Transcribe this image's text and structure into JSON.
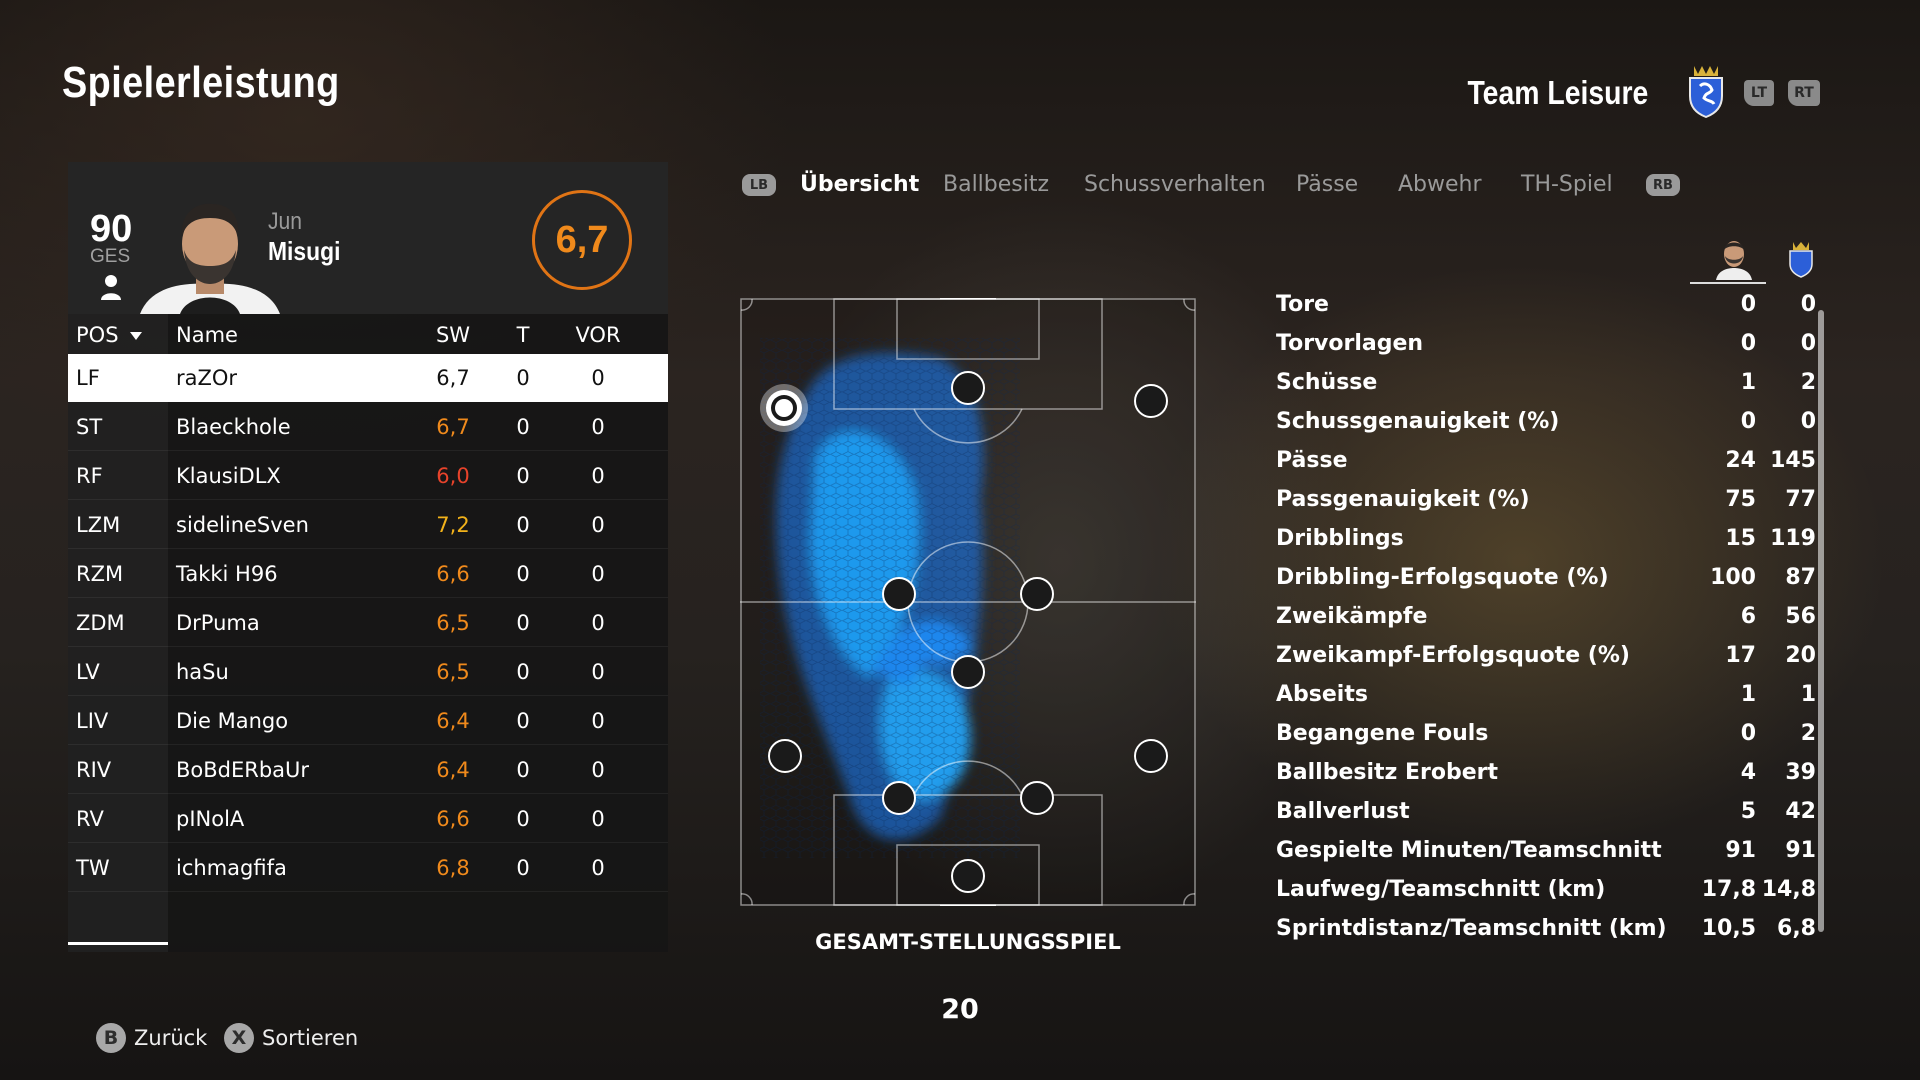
{
  "header": {
    "title": "Spielerleistung",
    "team_name": "Team Leisure",
    "lt_label": "LT",
    "rt_label": "RT"
  },
  "player_card": {
    "overall": "90",
    "overall_label": "GES",
    "first_name": "Jun",
    "last_name": "Misugi",
    "rating": "6,7"
  },
  "table": {
    "columns": [
      "POS",
      "Name",
      "SW",
      "T",
      "VOR"
    ],
    "rows": [
      {
        "pos": "LF",
        "name": "raZOr",
        "sw": "6,7",
        "t": "0",
        "vor": "0",
        "color": "#111111"
      },
      {
        "pos": "ST",
        "name": "Blaeckhole",
        "sw": "6,7",
        "t": "0",
        "vor": "0",
        "color": "#f08a1c"
      },
      {
        "pos": "RF",
        "name": "KlausiDLX",
        "sw": "6,0",
        "t": "0",
        "vor": "0",
        "color": "#e8432b"
      },
      {
        "pos": "LZM",
        "name": "sidelineSven",
        "sw": "7,2",
        "t": "0",
        "vor": "0",
        "color": "#f2b21a"
      },
      {
        "pos": "RZM",
        "name": "Takki H96",
        "sw": "6,6",
        "t": "0",
        "vor": "0",
        "color": "#f08a1c"
      },
      {
        "pos": "ZDM",
        "name": "DrPuma",
        "sw": "6,5",
        "t": "0",
        "vor": "0",
        "color": "#f08a1c"
      },
      {
        "pos": "LV",
        "name": "haSu",
        "sw": "6,5",
        "t": "0",
        "vor": "0",
        "color": "#f08a1c"
      },
      {
        "pos": "LIV",
        "name": "Die Mango",
        "sw": "6,4",
        "t": "0",
        "vor": "0",
        "color": "#f08a1c"
      },
      {
        "pos": "RIV",
        "name": "BoBdERbaUr",
        "sw": "6,4",
        "t": "0",
        "vor": "0",
        "color": "#f08a1c"
      },
      {
        "pos": "RV",
        "name": "pINolA",
        "sw": "6,6",
        "t": "0",
        "vor": "0",
        "color": "#f08a1c"
      },
      {
        "pos": "TW",
        "name": "ichmagfifa",
        "sw": "6,8",
        "t": "0",
        "vor": "0",
        "color": "#f08a1c"
      }
    ]
  },
  "tabs": {
    "lb": "LB",
    "rb": "RB",
    "items": [
      "Übersicht",
      "Ballbesitz",
      "Schussverhalten",
      "Pässe",
      "Abwehr",
      "TH-Spiel"
    ]
  },
  "pitch": {
    "title": "GESAMT-STELLUNGSSPIEL",
    "number": "20"
  },
  "stats": [
    {
      "label": "Tore",
      "player": "0",
      "team": "0"
    },
    {
      "label": "Torvorlagen",
      "player": "0",
      "team": "0"
    },
    {
      "label": "Schüsse",
      "player": "1",
      "team": "2"
    },
    {
      "label": "Schussgenauigkeit (%)",
      "player": "0",
      "team": "0"
    },
    {
      "label": "Pässe",
      "player": "24",
      "team": "145"
    },
    {
      "label": "Passgenauigkeit (%)",
      "player": "75",
      "team": "77"
    },
    {
      "label": "Dribblings",
      "player": "15",
      "team": "119"
    },
    {
      "label": "Dribbling-Erfolgsquote (%)",
      "player": "100",
      "team": "87"
    },
    {
      "label": "Zweikämpfe",
      "player": "6",
      "team": "56"
    },
    {
      "label": "Zweikampf-Erfolgsquote (%)",
      "player": "17",
      "team": "20"
    },
    {
      "label": "Abseits",
      "player": "1",
      "team": "1"
    },
    {
      "label": "Begangene Fouls",
      "player": "0",
      "team": "2"
    },
    {
      "label": "Ballbesitz Erobert",
      "player": "4",
      "team": "39"
    },
    {
      "label": "Ballverlust",
      "player": "5",
      "team": "42"
    },
    {
      "label": "Gespielte Minuten/Teamschnitt",
      "player": "91",
      "team": "91"
    },
    {
      "label": "Laufweg/Teamschnitt (km)",
      "player": "17,8",
      "team": "14,8"
    },
    {
      "label": "Sprintdistanz/Teamschnitt (km)",
      "player": "10,5",
      "team": "6,8"
    }
  ],
  "footer": {
    "back_key": "B",
    "back_label": "Zurück",
    "sort_key": "X",
    "sort_label": "Sortieren"
  },
  "colors": {
    "accent_orange": "#f08a1c",
    "low_rating_red": "#e8432b",
    "high_rating_yellow": "#f2b21a",
    "heatmap_blue": "#1e8fff"
  }
}
